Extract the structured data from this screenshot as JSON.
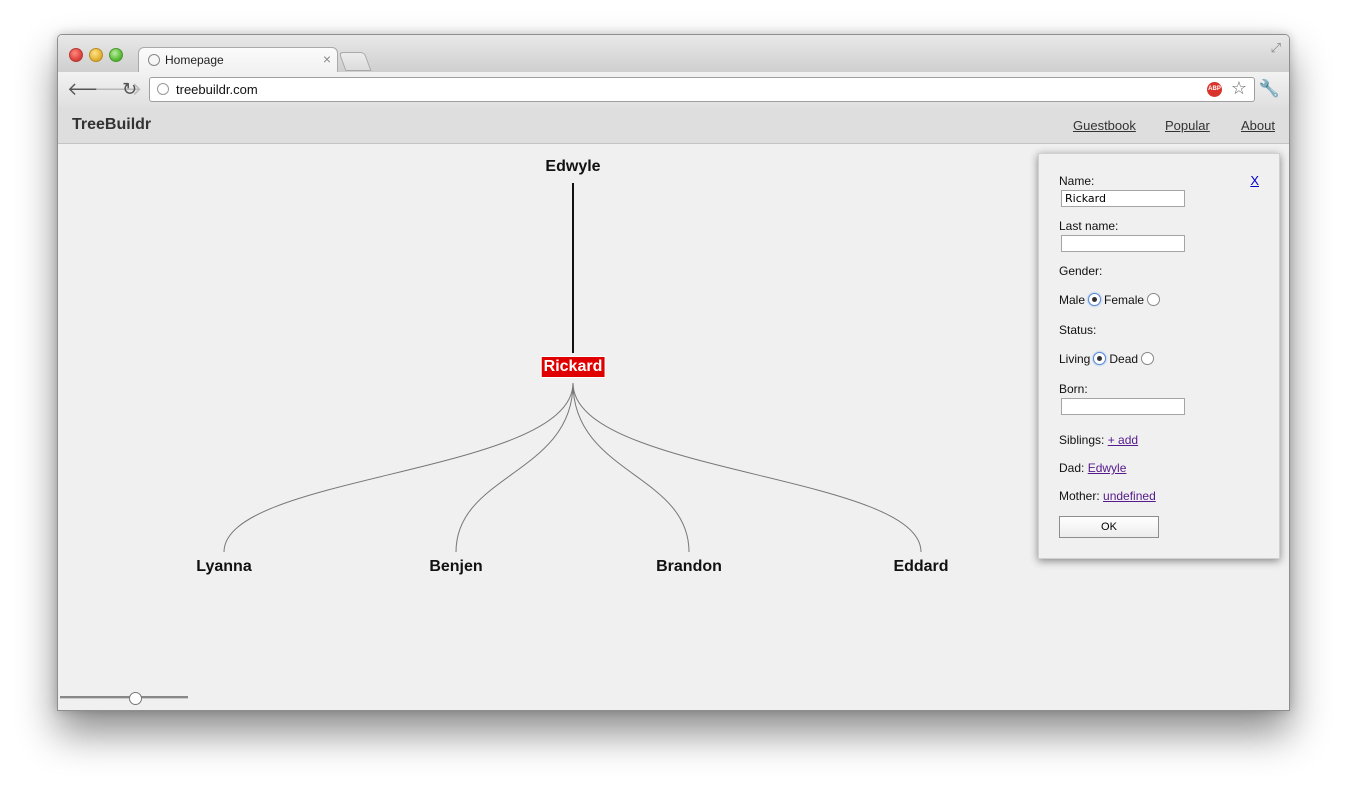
{
  "browser": {
    "tab_title": "Homepage",
    "tab_close": "×",
    "url": "treebuildr.com",
    "adblock_label": "ABP"
  },
  "icons": {
    "back": "🡐",
    "forward": "🡒",
    "reload": "↻",
    "star": "☆",
    "wrench": "🔧",
    "resize": "⤢"
  },
  "app": {
    "brand": "TreeBuildr",
    "nav": [
      "Guestbook",
      "Popular",
      "About"
    ]
  },
  "tree": {
    "parent": "Edwyle",
    "selected": "Rickard",
    "children": [
      "Lyanna",
      "Benjen",
      "Brandon",
      "Eddard"
    ],
    "selected_color": "#e00000"
  },
  "panel": {
    "close": "X",
    "name_label": "Name:",
    "name_value": "Rickard",
    "lastname_label": "Last name:",
    "lastname_value": "",
    "gender_label": "Gender:",
    "gender_male": "Male",
    "gender_female": "Female",
    "gender_selected": "Male",
    "status_label": "Status:",
    "status_living": "Living",
    "status_dead": "Dead",
    "status_selected": "Living",
    "born_label": "Born:",
    "born_value": "",
    "siblings_label": "Siblings:",
    "siblings_link": "+ add",
    "dad_label": "Dad:",
    "dad_link": "Edwyle",
    "mother_label": "Mother:",
    "mother_link": "undefined",
    "ok": "OK"
  }
}
